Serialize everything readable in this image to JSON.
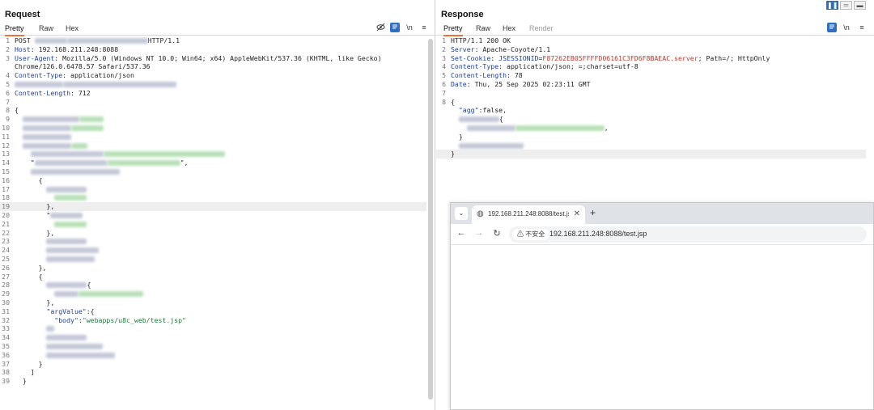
{
  "request": {
    "title": "Request",
    "tabs": [
      "Pretty",
      "Raw",
      "Hex"
    ],
    "active_tab": "Pretty",
    "newline_toggle": "\\n",
    "lines": [
      {
        "n": "1",
        "parts": [
          {
            "t": "POST "
          },
          {
            "blur": 40
          },
          {
            "blur": 100
          },
          {
            "t": "HTTP/1.1"
          }
        ]
      },
      {
        "n": "2",
        "parts": [
          {
            "t": "Host",
            "c": "k"
          },
          {
            "t": ": 192.168.211.248:8088"
          }
        ]
      },
      {
        "n": "3",
        "parts": [
          {
            "t": "User-Agent",
            "c": "k"
          },
          {
            "t": ": Mozilla/5.0 (Windows NT 10.0; Win64; x64) AppleWebKit/537.36 (KHTML, like Gecko)"
          }
        ]
      },
      {
        "n": "",
        "parts": [
          {
            "t": "Chrome/126.0.6478.57 Safari/537.36"
          }
        ]
      },
      {
        "n": "4",
        "parts": [
          {
            "t": "Content-Type",
            "c": "k"
          },
          {
            "t": ": application/json"
          }
        ]
      },
      {
        "n": "5",
        "parts": [
          {
            "blur": 60
          },
          {
            "blur": 140
          }
        ]
      },
      {
        "n": "6",
        "parts": [
          {
            "t": "Content-Length",
            "c": "k"
          },
          {
            "t": ": 712"
          }
        ]
      },
      {
        "n": "7",
        "parts": []
      },
      {
        "n": "8",
        "parts": [
          {
            "t": "{"
          }
        ]
      },
      {
        "n": "9",
        "parts": [
          {
            "t": "  "
          },
          {
            "blur": 70
          },
          {
            "blur": 30,
            "g": true
          }
        ]
      },
      {
        "n": "10",
        "parts": [
          {
            "t": "  "
          },
          {
            "blur": 60
          },
          {
            "blur": 40,
            "g": true
          }
        ]
      },
      {
        "n": "11",
        "parts": [
          {
            "t": "  "
          },
          {
            "blur": 60
          }
        ]
      },
      {
        "n": "12",
        "parts": [
          {
            "t": "  "
          },
          {
            "blur": 60
          },
          {
            "blur": 20,
            "g": true
          }
        ]
      },
      {
        "n": "13",
        "parts": [
          {
            "t": "    "
          },
          {
            "blur": 90
          },
          {
            "blur": 150,
            "g": true
          }
        ]
      },
      {
        "n": "14",
        "parts": [
          {
            "t": "    \""
          },
          {
            "blur": 90
          },
          {
            "blur": 90,
            "g": true
          },
          {
            "t": "\","
          }
        ]
      },
      {
        "n": "15",
        "parts": [
          {
            "t": "    "
          },
          {
            "blur": 110
          }
        ]
      },
      {
        "n": "16",
        "parts": [
          {
            "t": "      {"
          }
        ]
      },
      {
        "n": "17",
        "parts": [
          {
            "t": "        "
          },
          {
            "blur": 50
          }
        ]
      },
      {
        "n": "18",
        "parts": [
          {
            "t": "          "
          },
          {
            "blur": 40,
            "g": true
          }
        ]
      },
      {
        "n": "19",
        "parts": [
          {
            "t": "        },"
          }
        ],
        "hl": true
      },
      {
        "n": "20",
        "parts": [
          {
            "t": "        \""
          },
          {
            "blur": 40
          }
        ]
      },
      {
        "n": "21",
        "parts": [
          {
            "t": "          "
          },
          {
            "blur": 40,
            "g": true
          }
        ]
      },
      {
        "n": "22",
        "parts": [
          {
            "t": "        },"
          }
        ]
      },
      {
        "n": "23",
        "parts": [
          {
            "t": "        "
          },
          {
            "blur": 50
          }
        ]
      },
      {
        "n": "24",
        "parts": [
          {
            "t": "        "
          },
          {
            "blur": 65
          }
        ]
      },
      {
        "n": "25",
        "parts": [
          {
            "t": "        "
          },
          {
            "blur": 60
          }
        ]
      },
      {
        "n": "26",
        "parts": [
          {
            "t": "      },"
          }
        ]
      },
      {
        "n": "27",
        "parts": [
          {
            "t": "      {"
          }
        ]
      },
      {
        "n": "28",
        "parts": [
          {
            "t": "        "
          },
          {
            "blur": 50
          },
          {
            "t": "{"
          }
        ]
      },
      {
        "n": "29",
        "parts": [
          {
            "t": "          "
          },
          {
            "blur": 30
          },
          {
            "blur": 80,
            "g": true
          }
        ]
      },
      {
        "n": "30",
        "parts": [
          {
            "t": "        },"
          }
        ]
      },
      {
        "n": "31",
        "parts": [
          {
            "t": "        \"argValue\"",
            "c": "k"
          },
          {
            "t": ":{"
          }
        ]
      },
      {
        "n": "32",
        "parts": [
          {
            "t": "          \"body\"",
            "c": "k"
          },
          {
            "t": ":"
          },
          {
            "t": "\"webapps/u8c_web/test.jsp\"",
            "c": "s"
          }
        ]
      },
      {
        "n": "33",
        "parts": [
          {
            "t": "        "
          },
          {
            "blur": 10
          }
        ]
      },
      {
        "n": "34",
        "parts": [
          {
            "t": "        "
          },
          {
            "blur": 50
          }
        ]
      },
      {
        "n": "35",
        "parts": [
          {
            "t": "        "
          },
          {
            "blur": 70
          }
        ]
      },
      {
        "n": "36",
        "parts": [
          {
            "t": "        "
          },
          {
            "blur": 85
          }
        ]
      },
      {
        "n": "37",
        "parts": [
          {
            "t": "      }"
          }
        ]
      },
      {
        "n": "38",
        "parts": [
          {
            "t": "    ]"
          }
        ]
      },
      {
        "n": "39",
        "parts": [
          {
            "t": "  }"
          }
        ]
      }
    ]
  },
  "response": {
    "title": "Response",
    "tabs": [
      "Pretty",
      "Raw",
      "Hex",
      "Render"
    ],
    "active_tab": "Pretty",
    "newline_toggle": "\\n",
    "lines": [
      {
        "n": "1",
        "parts": [
          {
            "t": "HTTP/1.1 200 OK"
          }
        ]
      },
      {
        "n": "2",
        "parts": [
          {
            "t": "Server",
            "c": "k"
          },
          {
            "t": ": Apache-Coyote/1.1"
          }
        ]
      },
      {
        "n": "3",
        "parts": [
          {
            "t": "Set-Cookie",
            "c": "k"
          },
          {
            "t": ": "
          },
          {
            "t": "JSESSIONID",
            "c": "k"
          },
          {
            "t": "="
          },
          {
            "t": "F87262EB05FFFFD06161C3FD6F8BAEAC.server",
            "c": "r"
          },
          {
            "t": "; Path=/; HttpOnly"
          }
        ]
      },
      {
        "n": "4",
        "parts": [
          {
            "t": "Content-Type",
            "c": "k"
          },
          {
            "t": ": application/json; =;charset=utf-8"
          }
        ]
      },
      {
        "n": "5",
        "parts": [
          {
            "t": "Content-Length",
            "c": "k"
          },
          {
            "t": ": 78"
          }
        ]
      },
      {
        "n": "6",
        "parts": [
          {
            "t": "Date",
            "c": "k"
          },
          {
            "t": ": Thu, 25 Sep 2025 02:23:11 GMT"
          }
        ]
      },
      {
        "n": "7",
        "parts": []
      },
      {
        "n": "8",
        "parts": [
          {
            "t": "{"
          }
        ]
      },
      {
        "n": "",
        "parts": [
          {
            "t": "  \"agg\"",
            "c": "k"
          },
          {
            "t": ":false,"
          }
        ]
      },
      {
        "n": "",
        "parts": [
          {
            "t": "  "
          },
          {
            "blur": 50
          },
          {
            "t": "{"
          }
        ]
      },
      {
        "n": "",
        "parts": [
          {
            "t": "    "
          },
          {
            "blur": 60
          },
          {
            "blur": 110,
            "g": true
          },
          {
            "t": ","
          }
        ]
      },
      {
        "n": "",
        "parts": [
          {
            "t": "  }"
          }
        ]
      },
      {
        "n": "",
        "parts": [
          {
            "t": "  "
          },
          {
            "blur": 80
          }
        ]
      },
      {
        "n": "",
        "parts": [
          {
            "t": "}"
          }
        ],
        "hl": true
      }
    ]
  },
  "browser": {
    "tab_title": "192.168.211.248:8088/test.jsp",
    "security_label": "不安全",
    "url": "192.168.211.248:8088/test.jsp"
  }
}
